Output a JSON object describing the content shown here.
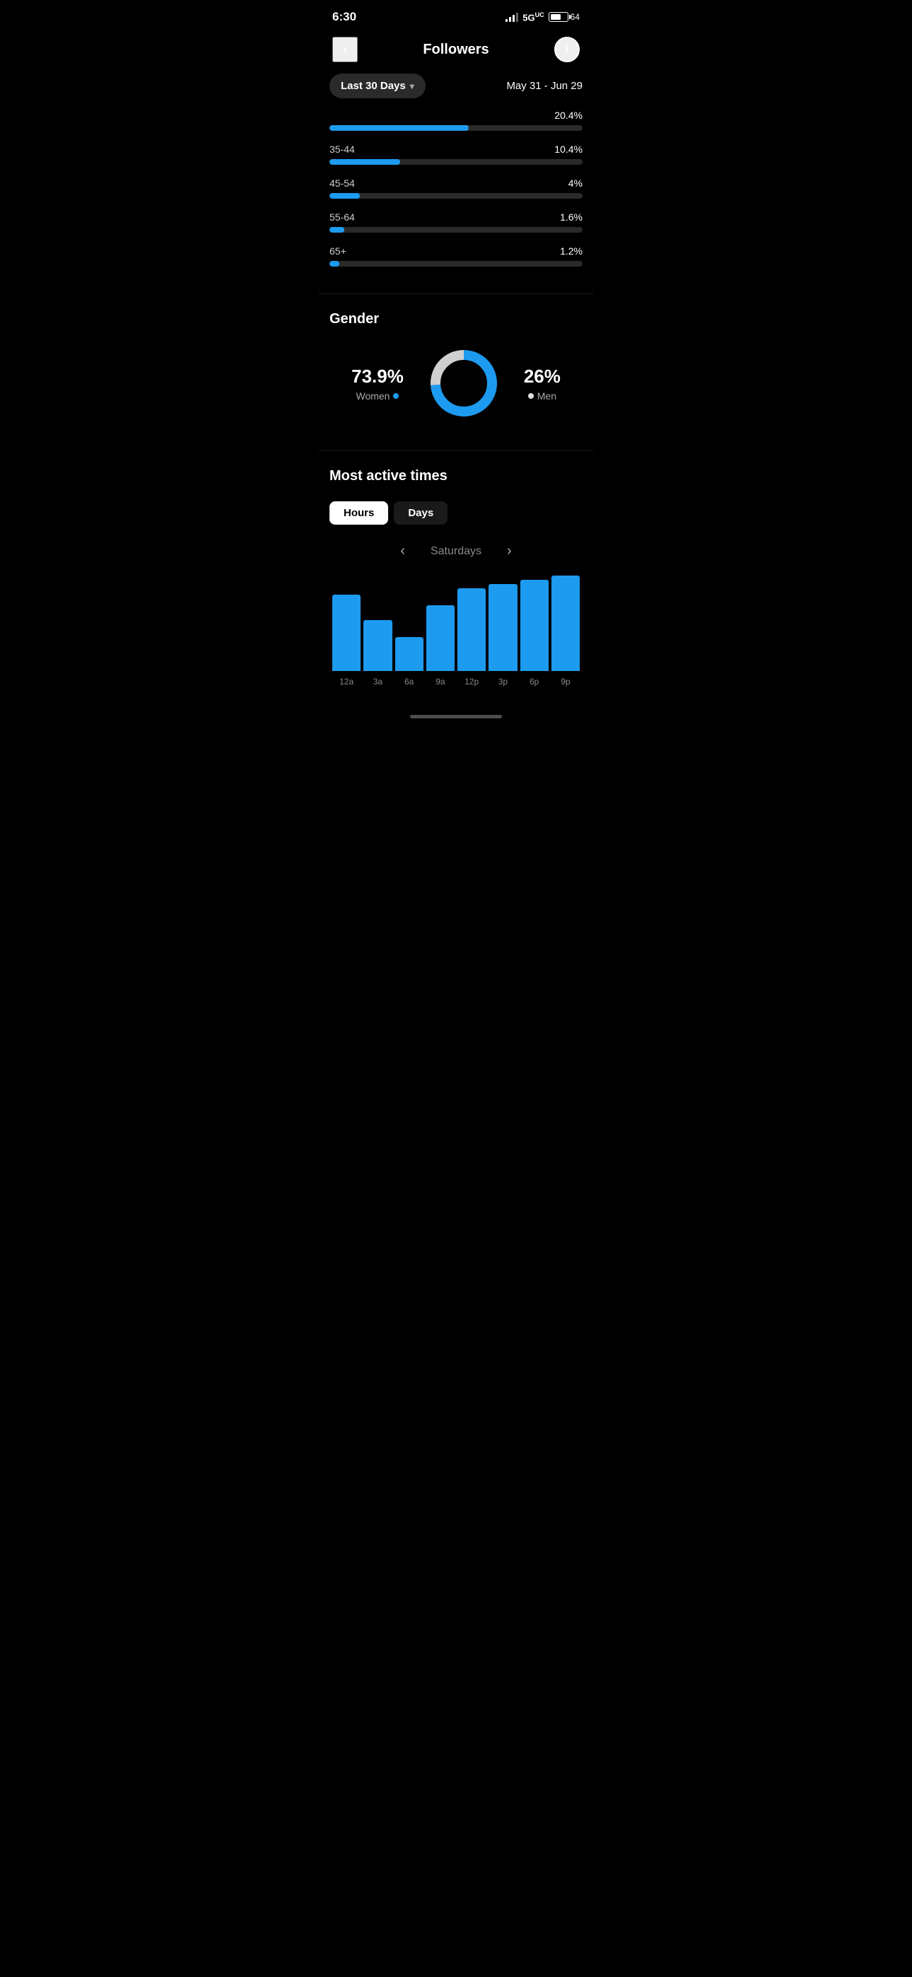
{
  "statusBar": {
    "time": "6:30",
    "network": "5G",
    "batteryPct": "64"
  },
  "header": {
    "title": "Followers",
    "backLabel": "<",
    "infoLabel": "i"
  },
  "filter": {
    "label": "Last 30 Days",
    "dateRange": "May 31 - Jun 29"
  },
  "ageBars": [
    {
      "label": "35-44",
      "pct": "10.4%",
      "width": 28
    },
    {
      "label": "45-54",
      "pct": "4%",
      "width": 12
    },
    {
      "label": "55-64",
      "pct": "1.6%",
      "width": 6
    },
    {
      "label": "65+",
      "pct": "1.2%",
      "width": 4
    }
  ],
  "topBar": {
    "pct": "20.4%",
    "width": 55
  },
  "gender": {
    "title": "Gender",
    "women": {
      "pct": "73.9%",
      "label": "Women"
    },
    "men": {
      "pct": "26%",
      "label": "Men"
    },
    "womenAngle": 266,
    "menAngle": 94
  },
  "activeTimesSection": {
    "title": "Most active times",
    "tabs": [
      {
        "label": "Hours",
        "active": true
      },
      {
        "label": "Days",
        "active": false
      }
    ],
    "currentDay": "Saturdays",
    "bars": [
      {
        "label": "12a",
        "heightPct": 72
      },
      {
        "label": "3a",
        "heightPct": 48
      },
      {
        "label": "6a",
        "heightPct": 32
      },
      {
        "label": "9a",
        "heightPct": 62
      },
      {
        "label": "12p",
        "heightPct": 78
      },
      {
        "label": "3p",
        "heightPct": 82
      },
      {
        "label": "6p",
        "heightPct": 86
      },
      {
        "label": "9p",
        "heightPct": 90
      }
    ]
  },
  "colors": {
    "accent": "#1d9bf0",
    "bg": "#000000",
    "barTrack": "#2a2a2a"
  }
}
